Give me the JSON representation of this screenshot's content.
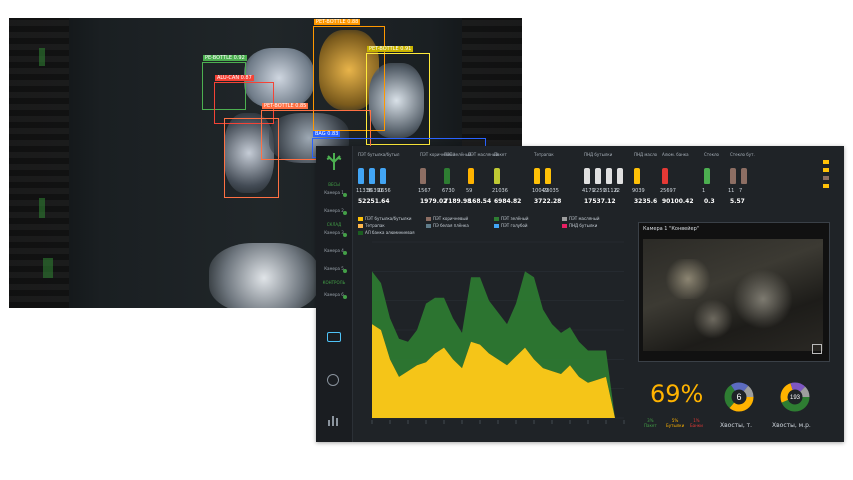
{
  "detections": [
    {
      "label": "PE-BOTTLE 0.92",
      "color": "#4caf50"
    },
    {
      "label": "ALU-CAN 0.87",
      "color": "#f44336"
    },
    {
      "label": "PET-BOTTLE 0.88",
      "color": "#ff9800"
    },
    {
      "label": "PET-BOTTLE 0.91",
      "color": "#ffeb3b"
    },
    {
      "label": "PET-BOTTLE 0.85",
      "color": "#ff7043"
    },
    {
      "label": "BAG 0.83",
      "color": "#2962ff"
    }
  ],
  "products": [
    {
      "label": "ПЭТ бутылка/бутыл",
      "counts": [
        "11336",
        "36391",
        "1656"
      ],
      "total": "52251.64"
    },
    {
      "label": "ПЭТ коричневый",
      "counts": [
        "1567"
      ],
      "total": "1979.02"
    },
    {
      "label": "ПЭТ зелёный",
      "counts": [
        "6730"
      ],
      "total": "7189.98"
    },
    {
      "label": "ПЭТ масляный",
      "counts": [
        "59"
      ],
      "total": "168.54"
    },
    {
      "label": "Пакет",
      "counts": [
        "21036"
      ],
      "total": "6984.82"
    },
    {
      "label": "Тетрапак",
      "counts": [
        "10049",
        "23035"
      ],
      "total": "3722.28"
    },
    {
      "label": "ПНД бутылки",
      "counts": [
        "4179",
        "2259",
        "31122",
        "6"
      ],
      "total": "17537.12"
    },
    {
      "label": "ПНД масло",
      "counts": [
        "9039"
      ],
      "total": "3235.6"
    },
    {
      "label": "Алюм. банка",
      "counts": [
        "25697"
      ],
      "total": "90100.42"
    },
    {
      "label": "Стекло",
      "counts": [
        "1"
      ],
      "total": "0.3"
    },
    {
      "label": "Стекло бут.",
      "counts": [
        "11",
        "7"
      ],
      "total": "5.57"
    }
  ],
  "legend": [
    {
      "label": "ПЭТ бутылка/бутылки",
      "color": "#ffc107"
    },
    {
      "label": "ПЭТ коричневый",
      "color": "#8d6e63"
    },
    {
      "label": "ПЭТ зелёный",
      "color": "#2e7d32"
    },
    {
      "label": "ПЭТ масляный",
      "color": "#9e9e9e"
    },
    {
      "label": "Тетрапак",
      "color": "#ffb74d"
    },
    {
      "label": "ПЭ белая плёнка",
      "color": "#607d8b"
    },
    {
      "label": "ПЭТ голубой",
      "color": "#42a5f5"
    },
    {
      "label": "ПНД бутылки",
      "color": "#e91e63"
    },
    {
      "label": "АЛ банка алюминиевая",
      "color": "#1b5e20"
    }
  ],
  "chart_data": {
    "type": "area",
    "series": [
      {
        "name": "ПЭТ бутылка/бутылки",
        "color": "#f5c518",
        "values": [
          1600,
          1500,
          1000,
          700,
          800,
          900,
          950,
          1100,
          1200,
          1000,
          850,
          1300,
          1250,
          1100,
          1000,
          900,
          1050,
          1200,
          1000,
          850,
          800,
          750,
          900,
          700,
          600,
          650,
          700,
          0,
          0
        ]
      },
      {
        "name": "АЛ банка алюминиевая",
        "color": "#2e7d32",
        "values": [
          900,
          800,
          700,
          650,
          500,
          600,
          1000,
          950,
          850,
          700,
          600,
          1100,
          1150,
          900,
          800,
          700,
          900,
          1300,
          1400,
          1000,
          800,
          700,
          650,
          600,
          550,
          500,
          450,
          0,
          0
        ]
      }
    ],
    "ylim": [
      0,
      3000
    ]
  },
  "camera": {
    "title": "Камера 1 \"Конвейер\""
  },
  "summary": {
    "percent": "69%",
    "mini": [
      {
        "value": "3%",
        "label": "Пакет",
        "color": "#43a047"
      },
      {
        "value": "5%",
        "label": "Бутылки",
        "color": "#ffb300"
      },
      {
        "value": "1%",
        "label": "Банки",
        "color": "#e53935"
      }
    ],
    "donut1": {
      "center": "6",
      "label": "Хвосты, т."
    },
    "donut2": {
      "center": "193",
      "label": "Хвосты, м.р."
    }
  },
  "sidebar": {
    "items": [
      "Камера 1",
      "Камера 2",
      "Камера 3",
      "Камера 4",
      "Камера 5",
      "Камера 6"
    ],
    "labels": [
      "ВЕСЫ",
      "СКЛАД",
      "КОНТРОЛЬ"
    ]
  }
}
